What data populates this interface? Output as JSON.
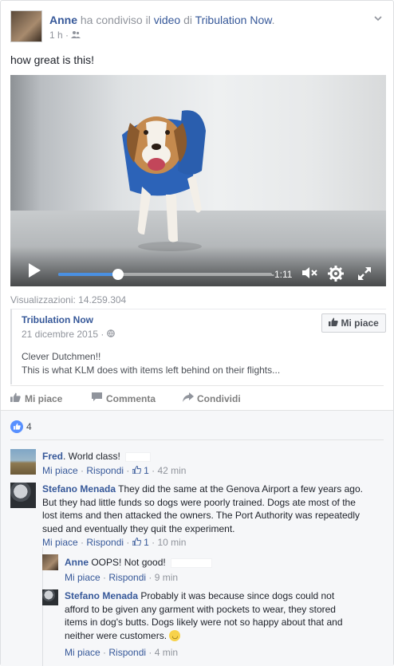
{
  "post": {
    "author": "Anne",
    "shared_text": "ha condiviso il",
    "video_link": "video",
    "di_text": "di",
    "page_link": "Tribulation Now",
    "period": ".",
    "time": "1 h",
    "audience_icon": "friends-icon",
    "caption": "how great is this!"
  },
  "video": {
    "time_remaining": "-1:11",
    "progress": 0.28,
    "icons": [
      "play-icon",
      "mute-icon",
      "settings-gear-icon",
      "fullscreen-icon"
    ]
  },
  "views": "Visualizzazioni: 14.259.304",
  "shared_post": {
    "page": "Tribulation Now",
    "date": "21 dicembre 2015",
    "text_line1": "Clever Dutchmen!!",
    "text_line2": "This is what KLM does with items left behind on their flights...",
    "like_page_button": "Mi piace"
  },
  "actions": {
    "like": "Mi piace",
    "comment": "Commenta",
    "share": "Condividi"
  },
  "reactions": {
    "count": "4"
  },
  "comments": [
    {
      "author": "Fred",
      "text": ". World class!",
      "like": "Mi piace",
      "reply": "Rispondi",
      "likes": "1",
      "time": "42 min"
    },
    {
      "author": "Stefano Menada",
      "text_line1": "They did the same at the Genova Airport a few years ago.",
      "text_line2": "But they had little funds so dogs were poorly trained. Dogs ate most of the",
      "text_line3": "lost items and then attacked the owners. The Port Authority was repeatedly",
      "text_line4": "sued and eventually they quit the experiment.",
      "like": "Mi piace",
      "reply": "Rispondi",
      "likes": "1",
      "time": "10 min"
    }
  ],
  "replies": [
    {
      "author": "Anne",
      "text": "OOPS! Not good!",
      "like": "Mi piace",
      "reply": "Rispondi",
      "time": "9 min"
    },
    {
      "author": "Stefano Menada",
      "text_line1": "Probably it was because since dogs could not",
      "text_line2": "afford to be given any garment with pockets to wear, they stored",
      "text_line3": "items in dog's butts. Dogs likely were not so happy about that and",
      "text_line4": "neither were customers.",
      "like": "Mi piace",
      "reply": "Rispondi",
      "time": "4 min"
    }
  ],
  "colors": {
    "link": "#365899",
    "muted": "#90949c",
    "accent": "#4a90e2",
    "like_blue": "#5890ff"
  }
}
